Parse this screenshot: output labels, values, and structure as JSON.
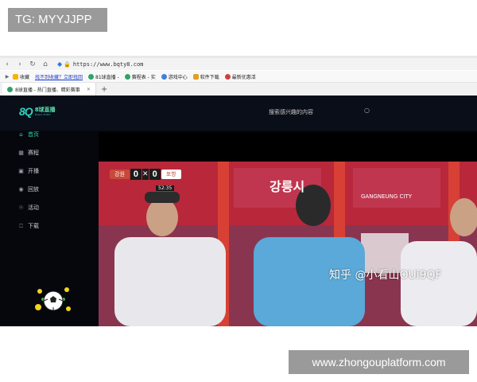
{
  "overlay": {
    "tg_label": "TG: MYYJJPP",
    "footer_label": "www.zhongouplatform.com"
  },
  "browser": {
    "url": "https://www.bqty8.com",
    "bookmarks": [
      {
        "label": "收藏",
        "link": false
      },
      {
        "label": "找不到收藏？立即找回",
        "link": true
      },
      {
        "label": "81球直播 - ",
        "link": false
      },
      {
        "label": "赛程表 - 实",
        "link": false
      },
      {
        "label": "游戏中心",
        "link": false
      },
      {
        "label": "软件下载",
        "link": false
      },
      {
        "label": "最新优惠活",
        "link": false
      }
    ],
    "tab_title": "8球直播 - 热门直播、精彩赛事",
    "add_tab": "+"
  },
  "site": {
    "logo_mark": "8Q",
    "logo_text": "8球直播",
    "logo_sub": "BAQIU ZHIBO",
    "search_placeholder": "搜索感兴趣的内容",
    "nav": [
      {
        "label": "首页",
        "icon": "home-icon",
        "active": true
      },
      {
        "label": "赛程",
        "icon": "calendar-icon",
        "active": false
      },
      {
        "label": "开播",
        "icon": "broadcast-icon",
        "active": false
      },
      {
        "label": "回放",
        "icon": "replay-icon",
        "active": false
      },
      {
        "label": "活动",
        "icon": "activity-icon",
        "active": false
      },
      {
        "label": "下载",
        "icon": "download-icon",
        "active": false
      }
    ]
  },
  "video": {
    "home_team": "강원",
    "home_score": "0",
    "away_score": "0",
    "away_team": "포항",
    "clock": "52:35",
    "banner_text_1": "강릉시",
    "banner_text_2": "GANGNEUNG CITY",
    "watermark": "知乎 @小看山OUi9QF"
  },
  "colors": {
    "accent": "#2fd6a8",
    "scene_red": "#b8283a"
  }
}
